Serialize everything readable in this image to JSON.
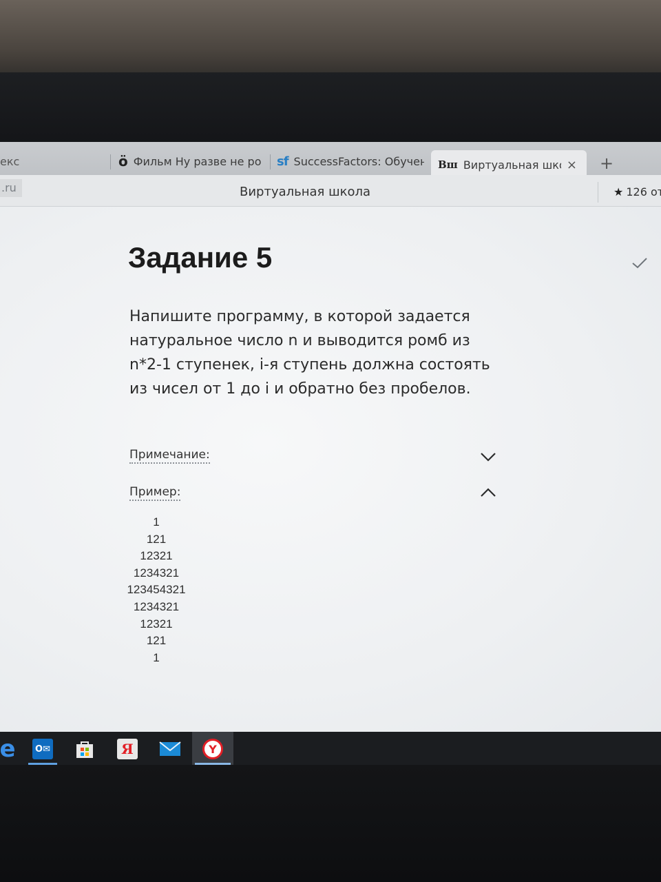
{
  "tabs": [
    {
      "label": "екс"
    },
    {
      "label": "Фильм Ну разве не ро",
      "icon": "film-icon"
    },
    {
      "label": "SuccessFactors: Обучен",
      "icon": "sf-icon"
    },
    {
      "label": "Виртуальная школа",
      "icon": "vsh-icon",
      "active": true,
      "close": "×"
    }
  ],
  "new_tab": "+",
  "addressbar": {
    "url_fragment": ".ru",
    "page_title": "Виртуальная школа",
    "rating": "126 от"
  },
  "task": {
    "title": "Задание 5",
    "text": "Напишите программу, в которой задается натуральное число n и выводится ромб из n*2-1 ступенек, i-я ступень должна состоять из чисел от 1 до i и обратно без пробелов.",
    "note_label": "Примечание:",
    "example_label": "Пример:",
    "example_output": [
      "1",
      "121",
      "12321",
      "1234321",
      "123454321",
      "1234321",
      "12321",
      "121",
      "1"
    ]
  },
  "taskbar": {
    "outlook_glyph": "O✉",
    "yandex_glyph": "Я",
    "ybrowser_glyph": "Y"
  }
}
